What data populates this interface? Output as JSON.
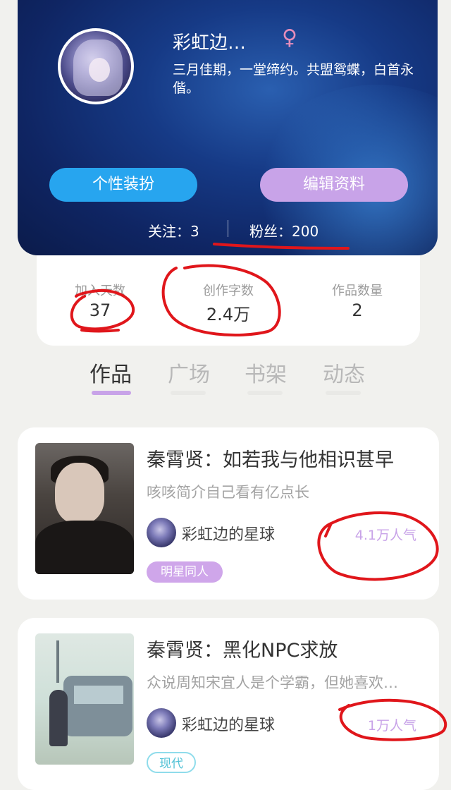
{
  "profile": {
    "name": "彩虹边…",
    "gender_symbol": "♀",
    "bio": "三月佳期，一堂缔约。共盟鸳蝶，白首永偕。",
    "dress_button": "个性装扮",
    "edit_button": "编辑资料",
    "following": "关注：3",
    "fans": "粉丝：200"
  },
  "stats": [
    {
      "label": "加入天数",
      "value": "37"
    },
    {
      "label": "创作字数",
      "value": "2.4万"
    },
    {
      "label": "作品数量",
      "value": "2"
    }
  ],
  "tabs": [
    "作品",
    "广场",
    "书架",
    "动态"
  ],
  "works": [
    {
      "title": "秦霄贤：如若我与他相识甚早",
      "desc": "咳咳简介自己看有亿点长",
      "author": "彩虹边的星球",
      "popularity": "4.1万人气",
      "tag": "明星同人"
    },
    {
      "title": "秦霄贤：黑化NPC求放",
      "desc": "众说周知宋宜人是个学霸，但她喜欢…",
      "author": "彩虹边的星球",
      "popularity": "1万人气",
      "tag": "现代"
    }
  ],
  "colors": {
    "accent_purple": "#c8a3e8",
    "accent_blue": "#27a5ef",
    "annotation_red": "#e0161b"
  }
}
